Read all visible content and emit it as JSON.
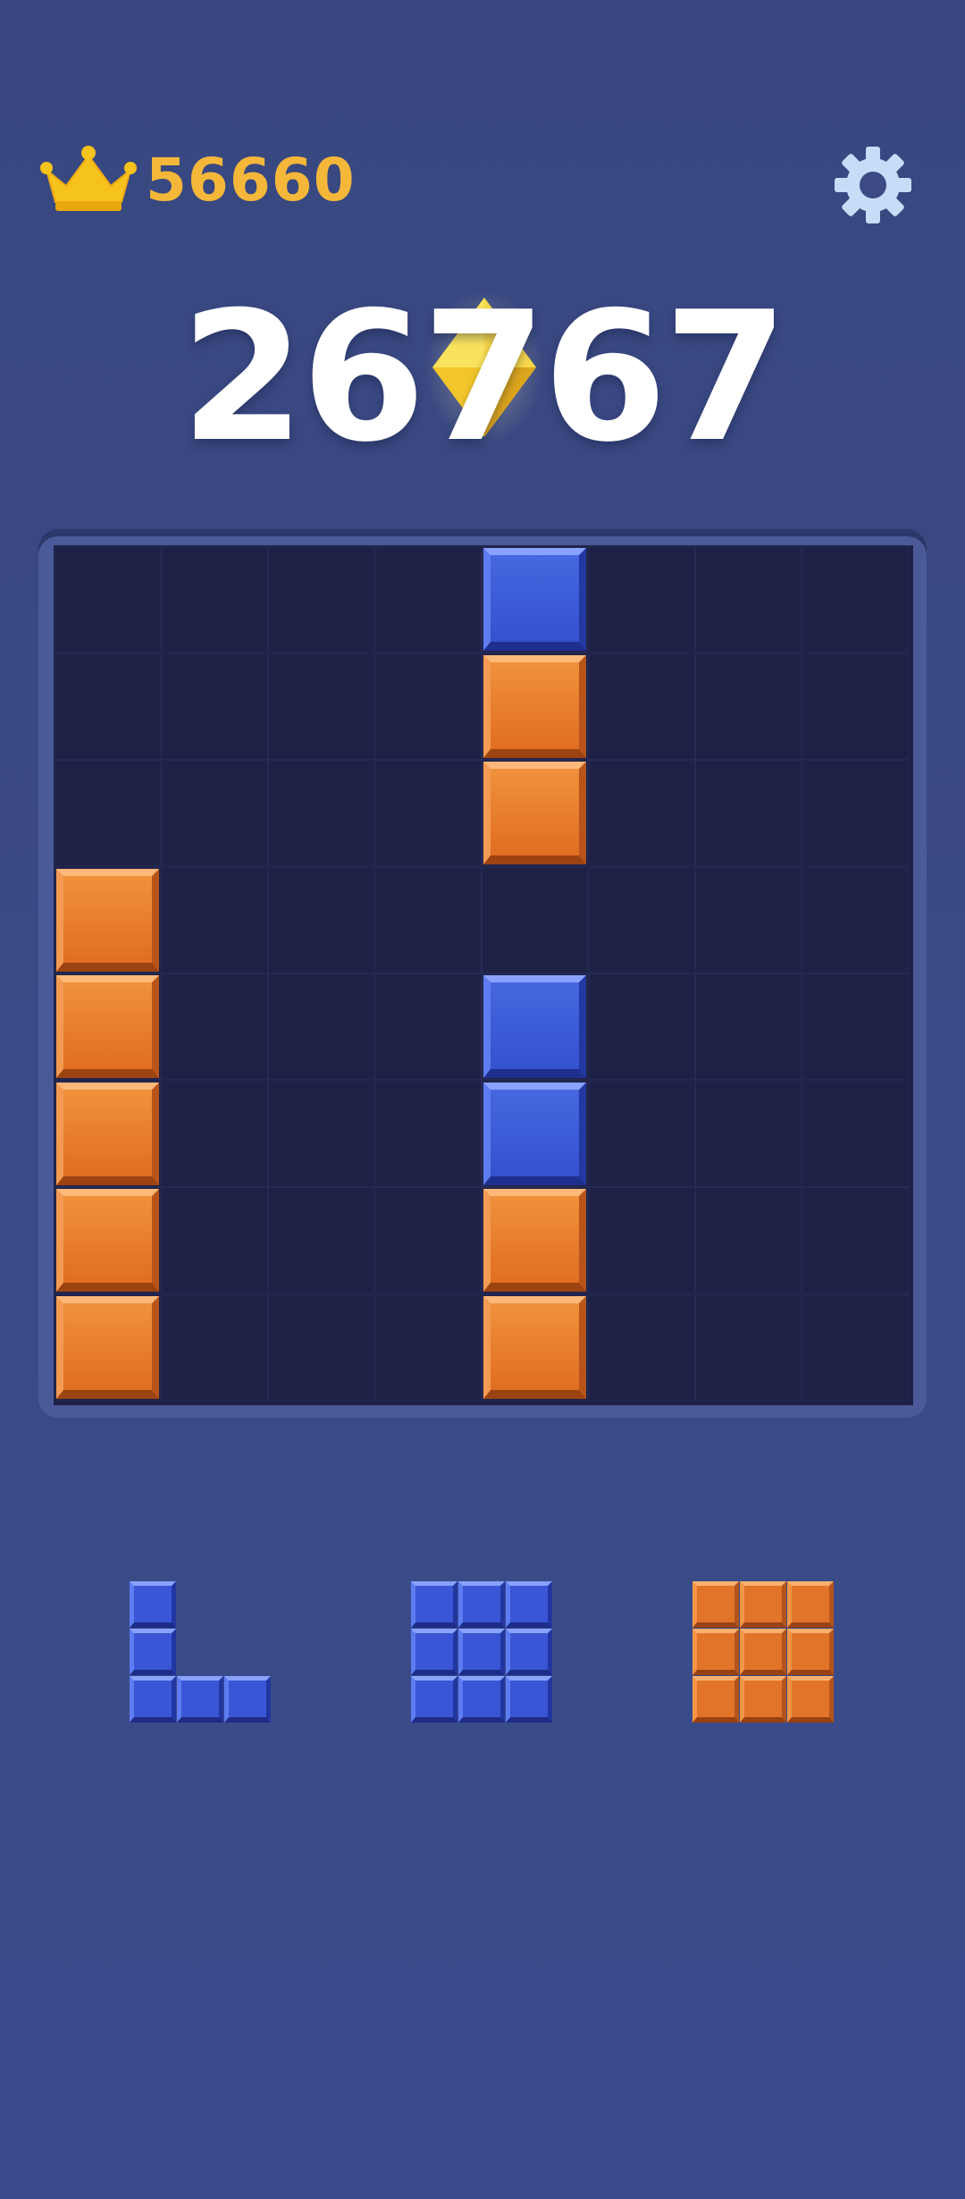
{
  "header": {
    "best_score": "56660",
    "crown_icon": "crown-icon",
    "settings_icon": "gear-icon"
  },
  "score": {
    "current": "26767",
    "gem_icon": "yellow-diamond-icon"
  },
  "colors": {
    "orange": "#e8772b",
    "blue": "#3a58d8",
    "board": "#1d2145",
    "best_score": "#f4b73a"
  },
  "board": {
    "rows": 8,
    "cols": 8,
    "filled": [
      {
        "row": 0,
        "col": 4,
        "color": "blue"
      },
      {
        "row": 1,
        "col": 4,
        "color": "orange"
      },
      {
        "row": 2,
        "col": 4,
        "color": "orange"
      },
      {
        "row": 3,
        "col": 0,
        "color": "orange"
      },
      {
        "row": 4,
        "col": 0,
        "color": "orange"
      },
      {
        "row": 4,
        "col": 4,
        "color": "blue"
      },
      {
        "row": 5,
        "col": 0,
        "color": "orange"
      },
      {
        "row": 5,
        "col": 4,
        "color": "blue"
      },
      {
        "row": 6,
        "col": 0,
        "color": "orange"
      },
      {
        "row": 6,
        "col": 4,
        "color": "orange"
      },
      {
        "row": 7,
        "col": 0,
        "color": "orange"
      },
      {
        "row": 7,
        "col": 4,
        "color": "orange"
      }
    ]
  },
  "tray": {
    "pieces": [
      {
        "name": "L-shape-piece",
        "color": "blue",
        "cells": [
          [
            0,
            0
          ],
          [
            1,
            0
          ],
          [
            2,
            0
          ],
          [
            2,
            1
          ],
          [
            2,
            2
          ]
        ]
      },
      {
        "name": "square-3x3-piece",
        "color": "blue",
        "cells": [
          [
            0,
            0
          ],
          [
            0,
            1
          ],
          [
            0,
            2
          ],
          [
            1,
            0
          ],
          [
            1,
            1
          ],
          [
            1,
            2
          ],
          [
            2,
            0
          ],
          [
            2,
            1
          ],
          [
            2,
            2
          ]
        ]
      },
      {
        "name": "square-3x3-piece",
        "color": "orange",
        "cells": [
          [
            0,
            0
          ],
          [
            0,
            1
          ],
          [
            0,
            2
          ],
          [
            1,
            0
          ],
          [
            1,
            1
          ],
          [
            1,
            2
          ],
          [
            2,
            0
          ],
          [
            2,
            1
          ],
          [
            2,
            2
          ]
        ]
      }
    ]
  }
}
